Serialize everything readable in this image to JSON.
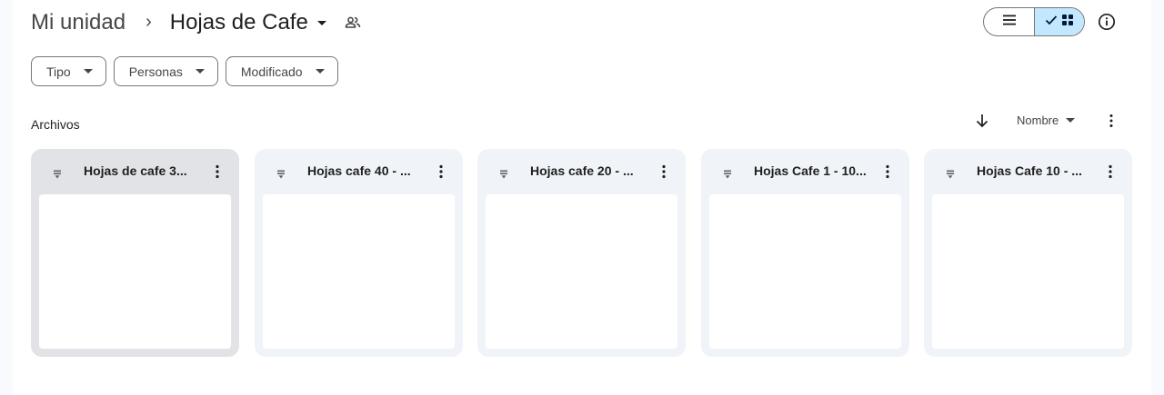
{
  "breadcrumb": {
    "root": "Mi unidad",
    "separator": "›",
    "current": "Hojas de Cafe"
  },
  "icons": {
    "share": "shared-folder-people-icon",
    "list_view": "list-view-icon",
    "grid_view": "grid-view-icon",
    "check": "check-icon",
    "info": "info-icon",
    "sort_arrow": "arrow-down-icon",
    "more": "more-vert-icon",
    "file": "sheets-file-icon"
  },
  "view_toggle": {
    "selected": "grid"
  },
  "filters": [
    {
      "label": "Tipo"
    },
    {
      "label": "Personas"
    },
    {
      "label": "Modificado"
    }
  ],
  "section": {
    "title": "Archivos"
  },
  "sort": {
    "label": "Nombre",
    "direction": "descending"
  },
  "files": [
    {
      "name": "Hojas de cafe 3...",
      "selected": true
    },
    {
      "name": "Hojas cafe 40 - ...",
      "selected": false
    },
    {
      "name": "Hojas cafe 20 - ...",
      "selected": false
    },
    {
      "name": "Hojas Cafe 1 - 10...",
      "selected": false
    },
    {
      "name": "Hojas Cafe 10 - ...",
      "selected": false
    }
  ],
  "colors": {
    "accent_selected": "#c2e7ff",
    "card_bg": "#f0f4f9",
    "card_selected_bg": "#e1e3e6"
  }
}
